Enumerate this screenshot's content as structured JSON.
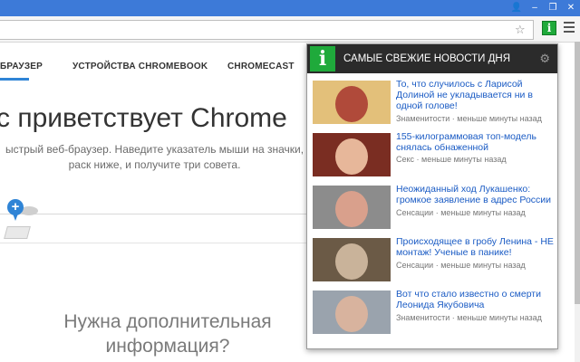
{
  "window": {
    "controls": [
      {
        "name": "user-icon",
        "glyph": "👤"
      },
      {
        "name": "minimize-icon",
        "glyph": "–"
      },
      {
        "name": "restore-icon",
        "glyph": "❐"
      },
      {
        "name": "close-icon",
        "glyph": "✕"
      }
    ]
  },
  "toolbar": {
    "star_glyph": "☆",
    "extension_glyph": "i"
  },
  "page": {
    "nav": [
      "БРАУЗЕР",
      "УСТРОЙСТВА CHROMEBOOK",
      "CHROMECAST"
    ],
    "headline": "с приветствует Chrome",
    "subtext": "ыстрый веб-браузер. Наведите указатель мыши на значки, раск ниже, и получите три совета.",
    "hint_plus": "+",
    "more_info": "Нужна дополнительная информация?"
  },
  "popup": {
    "logo_glyph": "i",
    "title": "САМЫЕ СВЕЖИЕ НОВОСТИ ДНЯ",
    "gear_glyph": "⚙",
    "news": [
      {
        "title": "То, что случилось с Ларисой Долиной не укладывается ни в одной голове!",
        "meta": "Знаменитости · меньше минуты назад",
        "thumb_colors": [
          "#e3c07a",
          "#b04a3a"
        ]
      },
      {
        "title": "155-килограммовая топ-модель снялась обнаженной",
        "meta": "Секс · меньше минуты назад",
        "thumb_colors": [
          "#7a2d22",
          "#e7b79a"
        ]
      },
      {
        "title": "Неожиданный ход Лукашенко: громкое заявление в адрес России",
        "meta": "Сенсации · меньше минуты назад",
        "thumb_colors": [
          "#8c8c8c",
          "#d9a08c"
        ]
      },
      {
        "title": "Происходящее в гробу Ленина - НЕ монтаж! Ученые в панике!",
        "meta": "Сенсации · меньше минуты назад",
        "thumb_colors": [
          "#6b5a46",
          "#c9b39a"
        ]
      },
      {
        "title": "Вот что стало известно о смерти Леонида Якубовича",
        "meta": "Знаменитости · меньше минуты назад",
        "thumb_colors": [
          "#9aa3ad",
          "#d8b39e"
        ]
      }
    ]
  },
  "colors": {
    "titlebar": "#3d7ad8",
    "accent_green": "#1faa3b",
    "link_blue": "#1a5bc4",
    "nav_active": "#2f84d6"
  }
}
